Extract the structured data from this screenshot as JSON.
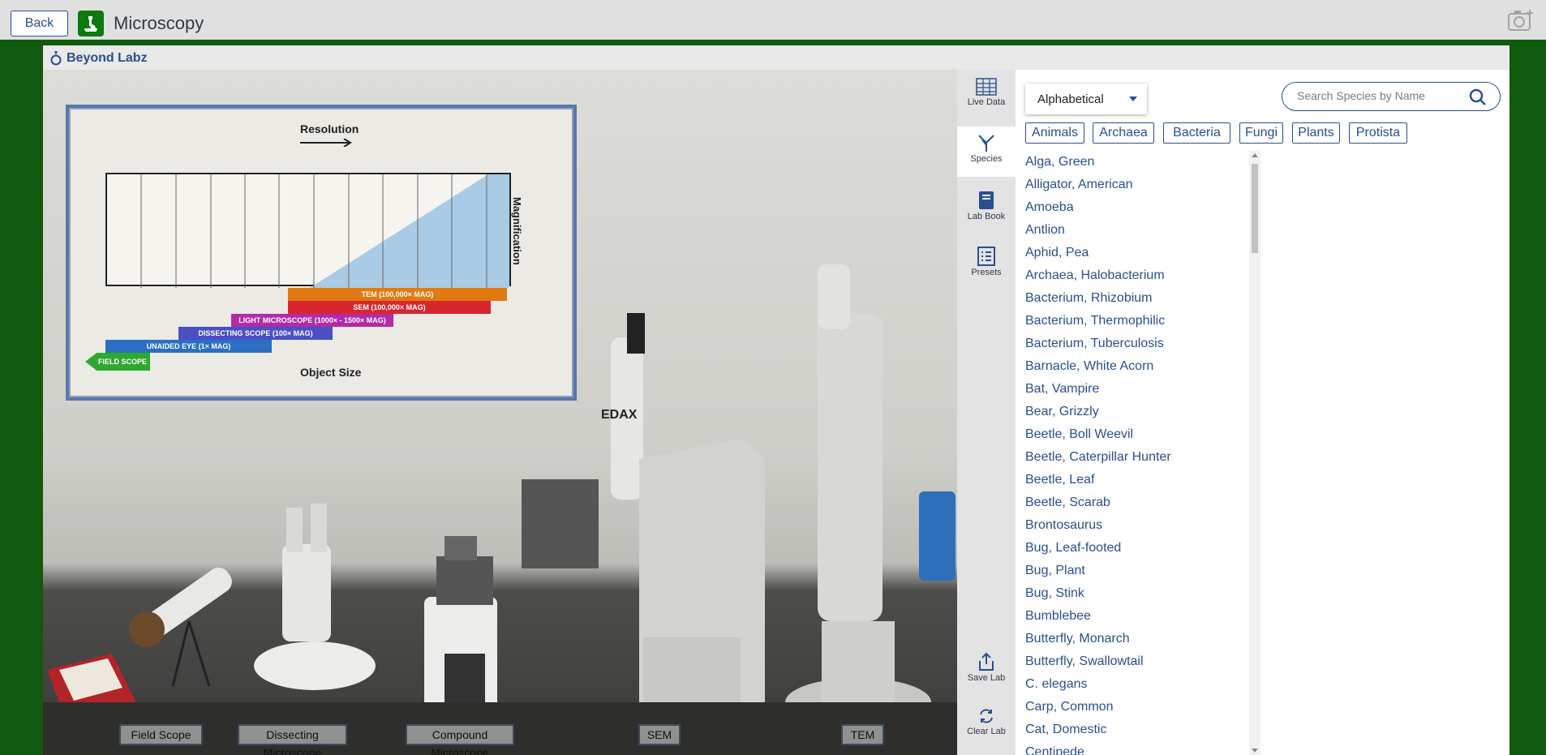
{
  "topbar": {
    "back_label": "Back",
    "title": "Microscopy"
  },
  "brand": {
    "name": "Beyond Labz"
  },
  "poster": {
    "resolution_label": "Resolution",
    "magnification_label": "Magnification",
    "object_size_label": "Object Size",
    "bands": {
      "tem": "TEM  (100,000× MAG)",
      "sem": "SEM  (100,000× MAG)",
      "light": "LIGHT MICROSCOPE  (1000× - 1500× MAG)",
      "dissecting": "DISSECTING SCOPE  (100× MAG)",
      "unaided": "UNAIDED EYE  (1× MAG)",
      "field": "FIELD SCOPE"
    }
  },
  "equipment": {
    "field_scope": "Field Scope",
    "dissecting": "Dissecting Microscope",
    "compound": "Compound Microscope",
    "sem": "SEM",
    "tem": "TEM",
    "edax_label": "EDAX",
    "lab_book_label": "Lab Book"
  },
  "rail": {
    "live_data": "Live Data",
    "species": "Species",
    "lab_book": "Lab Book",
    "presets": "Presets",
    "save_lab": "Save Lab",
    "clear_lab": "Clear Lab"
  },
  "panel": {
    "sort_value": "Alphabetical",
    "search_placeholder": "Search Species by Name",
    "filters": [
      "Animals",
      "Archaea",
      "Bacteria",
      "Fungi",
      "Plants",
      "Protista"
    ],
    "species": [
      "Alga, Green",
      "Alligator, American",
      "Amoeba",
      "Antlion",
      "Aphid, Pea",
      "Archaea, Halobacterium",
      "Bacterium, Rhizobium",
      "Bacterium, Thermophilic",
      "Bacterium, Tuberculosis",
      "Barnacle, White Acorn",
      "Bat, Vampire",
      "Bear, Grizzly",
      "Beetle, Boll Weevil",
      "Beetle, Caterpillar Hunter",
      "Beetle, Leaf",
      "Beetle, Scarab",
      "Brontosaurus",
      "Bug, Leaf-footed",
      "Bug, Plant",
      "Bug, Stink",
      "Bumblebee",
      "Butterfly, Monarch",
      "Butterfly, Swallowtail",
      "C. elegans",
      "Carp, Common",
      "Cat, Domestic",
      "Centipede"
    ]
  },
  "colors": {
    "accent": "#2a4f8e",
    "frame_green": "#0f5a0f"
  }
}
